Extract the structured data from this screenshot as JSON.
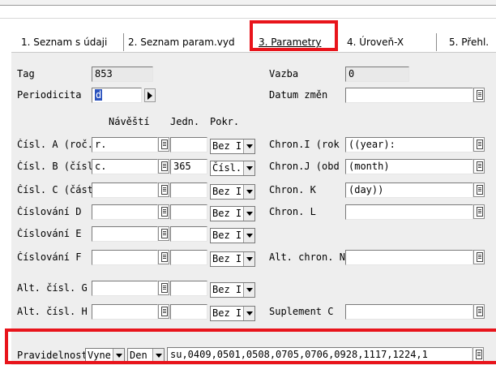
{
  "tabs": [
    {
      "label": "1. Seznam s údaji"
    },
    {
      "label": "2. Seznam param.vyd"
    },
    {
      "label": "3. Parametry",
      "active": true
    },
    {
      "label": "4. Úroveň-X"
    },
    {
      "label": "5. Přehl."
    }
  ],
  "highlight_color": "#e8141b",
  "header_row": {
    "tag_label": "Tag",
    "tag_value": "853",
    "vazba_label": "Vazba",
    "vazba_value": "0"
  },
  "periodicita": {
    "label": "Periodicita",
    "value": "d"
  },
  "datum_zmen": {
    "label": "Datum změn",
    "value": ""
  },
  "columns": {
    "navesti": "Návěští",
    "jedn": "Jedn.",
    "pokr": "Pokr."
  },
  "left_rows": [
    {
      "label": "Čísl. A (roč.)",
      "navesti": "r.",
      "jedn": "",
      "pokr": "Bez I"
    },
    {
      "label": "Čísl. B (číslo)",
      "navesti": "c.",
      "jedn": "365",
      "pokr": "Čísl. :"
    },
    {
      "label": "Čísl. C (část)",
      "navesti": "",
      "jedn": "",
      "pokr": "Bez I"
    },
    {
      "label": "Číslování D",
      "navesti": "",
      "jedn": "",
      "pokr": "Bez I"
    },
    {
      "label": "Číslování E",
      "navesti": "",
      "jedn": "",
      "pokr": "Bez I"
    },
    {
      "label": "Číslování F",
      "navesti": "",
      "jedn": "",
      "pokr": "Bez I"
    },
    {
      "label": "Alt. čísl. G",
      "navesti": "",
      "jedn": "",
      "pokr": "Bez I"
    },
    {
      "label": "Alt. čísl. H",
      "navesti": "",
      "jedn": "",
      "pokr": "Bez I"
    }
  ],
  "right_rows": [
    {
      "label": "Chron.I (rok",
      "value": "((year):"
    },
    {
      "label": "Chron.J (obd",
      "value": "(month)"
    },
    {
      "label": "Chron. K",
      "value": "(day))"
    },
    {
      "label": "Chron. L",
      "value": ""
    },
    {
      "label": "Alt. chron. N",
      "value": ""
    },
    {
      "label": "Suplement C",
      "value": ""
    }
  ],
  "pravidelnost": {
    "label": "Pravidelnost",
    "select1": "Vyne",
    "select2": "Den",
    "value": "su,0409,0501,0508,0705,0706,0928,1117,1224,1"
  }
}
